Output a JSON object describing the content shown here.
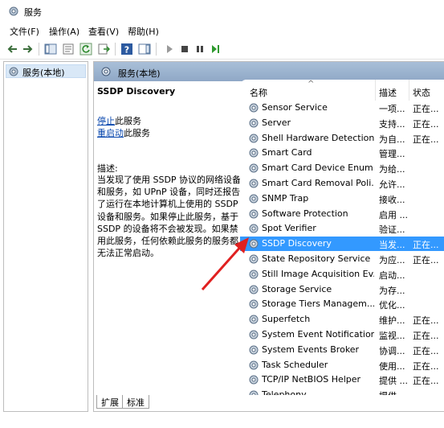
{
  "window": {
    "title": "服务"
  },
  "menu": [
    {
      "label": "文件(F)"
    },
    {
      "label": "操作(A)"
    },
    {
      "label": "查看(V)"
    },
    {
      "label": "帮助(H)"
    }
  ],
  "tree": {
    "root_label": "服务(本地)"
  },
  "panel": {
    "header_title": "服务(本地)",
    "selected_service": "SSDP Discovery",
    "stop_link": "停止",
    "stop_suffix": "此服务",
    "restart_link": "重启动",
    "restart_suffix": "此服务",
    "desc_label": "描述:",
    "desc_text": "当发现了使用 SSDP 协议的网络设备和服务，如 UPnP 设备，同时还报告了运行在本地计算机上使用的 SSDP 设备和服务。如果停止此服务，基于 SSDP 的设备将不会被发现。如果禁用此服务，任何依赖此服务的服务都无法正常启动。"
  },
  "columns": {
    "name": "名称",
    "desc": "描述",
    "status": "状态"
  },
  "services": [
    {
      "name": "Sensor Service",
      "desc": "一项...",
      "status": "正在..."
    },
    {
      "name": "Server",
      "desc": "支持...",
      "status": "正在..."
    },
    {
      "name": "Shell Hardware Detection",
      "desc": "为自...",
      "status": "正在..."
    },
    {
      "name": "Smart Card",
      "desc": "管理...",
      "status": ""
    },
    {
      "name": "Smart Card Device Enum...",
      "desc": "为给...",
      "status": ""
    },
    {
      "name": "Smart Card Removal Poli...",
      "desc": "允许...",
      "status": ""
    },
    {
      "name": "SNMP Trap",
      "desc": "接收...",
      "status": ""
    },
    {
      "name": "Software Protection",
      "desc": "启用 ...",
      "status": ""
    },
    {
      "name": "Spot Verifier",
      "desc": "验证...",
      "status": ""
    },
    {
      "name": "SSDP Discovery",
      "desc": "当发...",
      "status": "正在...",
      "selected": true
    },
    {
      "name": "State Repository Service",
      "desc": "为应...",
      "status": "正在..."
    },
    {
      "name": "Still Image Acquisition Ev...",
      "desc": "启动...",
      "status": ""
    },
    {
      "name": "Storage Service",
      "desc": "为存...",
      "status": ""
    },
    {
      "name": "Storage Tiers Managem...",
      "desc": "优化...",
      "status": ""
    },
    {
      "name": "Superfetch",
      "desc": "维护...",
      "status": "正在..."
    },
    {
      "name": "System Event Notification...",
      "desc": "监视...",
      "status": "正在..."
    },
    {
      "name": "System Events Broker",
      "desc": "协调...",
      "status": "正在..."
    },
    {
      "name": "Task Scheduler",
      "desc": "使用...",
      "status": "正在..."
    },
    {
      "name": "TCP/IP NetBIOS Helper",
      "desc": "提供 ...",
      "status": "正在..."
    },
    {
      "name": "Telephony",
      "desc": "提供...",
      "status": ""
    }
  ],
  "tabs": [
    {
      "label": "扩展"
    },
    {
      "label": "标准"
    }
  ],
  "colors": {
    "selected_row": "#3399ff",
    "link": "#0645ad",
    "annotation": "#e02020"
  }
}
